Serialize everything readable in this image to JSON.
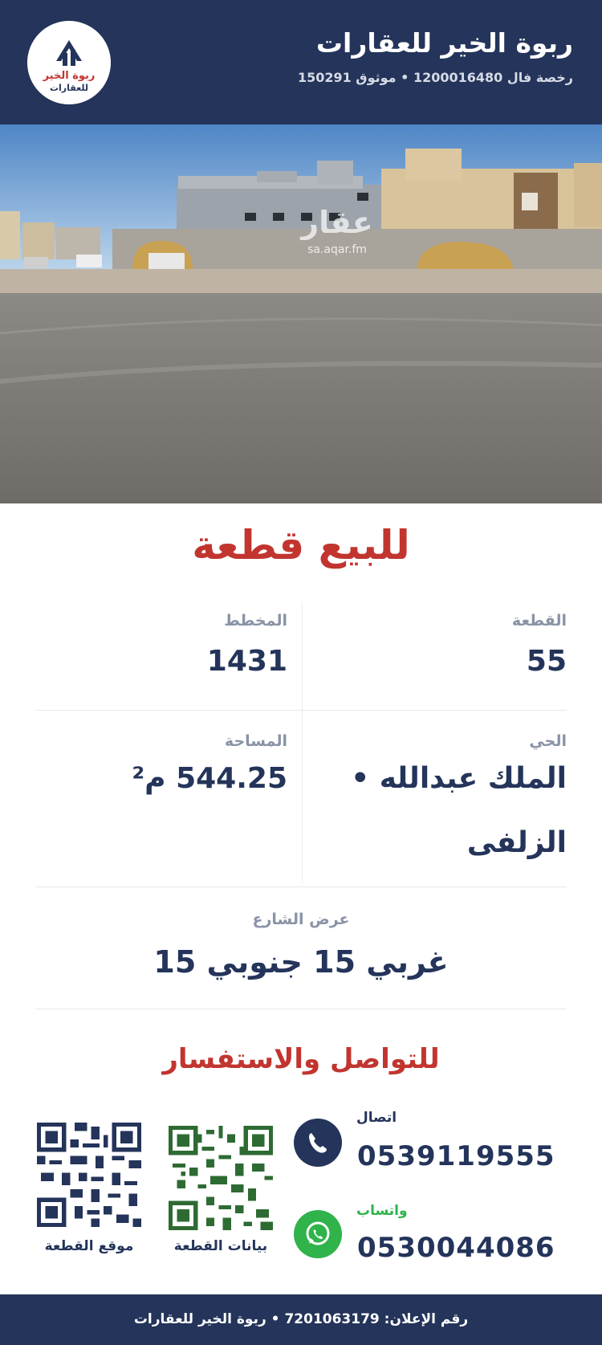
{
  "header": {
    "brand_name": "ربوة الخير للعقارات",
    "license_line": "رخصة فال 1200016480 • موثوق 150291",
    "logo_text": "ربوة الخير للعقارات"
  },
  "photo": {
    "watermark_text": "sa.aqar.fm",
    "watermark_logo": "عقار"
  },
  "title": "للبيع قطعة",
  "info": {
    "plot_label": "القطعة",
    "plot_value": "55",
    "scheme_label": "المخطط",
    "scheme_value": "1431",
    "district_label": "الحي",
    "district_value_line1": "الملك عبدالله •",
    "district_value_line2": "الزلفى",
    "area_label": "المساحة",
    "area_value": "544.25 م²",
    "street_label": "عرض الشارع",
    "street_value": "غربي 15 جنوبي 15"
  },
  "contact": {
    "title": "للتواصل والاستفسار",
    "call_label": "اتصال",
    "call_number": "0539119555",
    "whatsapp_label": "واتساب",
    "whatsapp_number": "0530044086",
    "qr_plot_data_caption": "بيانات القطعة",
    "qr_plot_location_caption": "موقع القطعة"
  },
  "footer": {
    "text": "رقم الإعلان: 7201063179 • ربوة الخير للعقارات"
  },
  "colors": {
    "navy": "#24345a",
    "accent_red": "#c2352f",
    "whatsapp_green": "#2fb34a",
    "qr_green": "#2e6b33",
    "label_gray": "#8a93a6"
  },
  "icons": {
    "call": "phone-icon",
    "whatsapp": "whatsapp-icon"
  }
}
